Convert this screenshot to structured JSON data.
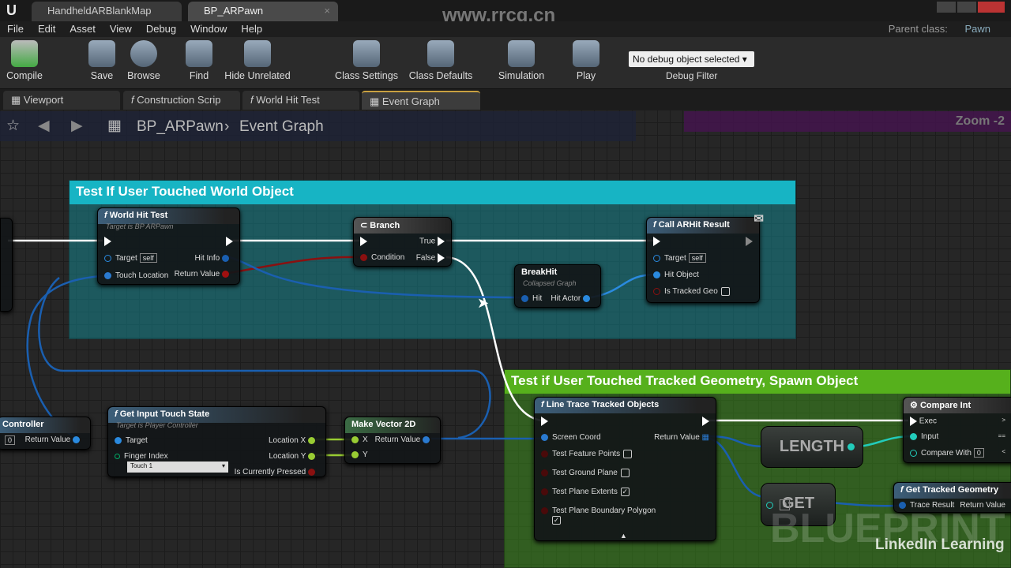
{
  "window": {
    "tabs": [
      {
        "label": "HandheldARBlankMap"
      },
      {
        "label": "BP_ARPawn"
      }
    ],
    "parent_class_label": "Parent class:",
    "parent_class": "Pawn"
  },
  "menu": [
    "File",
    "Edit",
    "Asset",
    "View",
    "Debug",
    "Window",
    "Help"
  ],
  "toolbar": {
    "compile": "Compile",
    "save": "Save",
    "browse": "Browse",
    "find": "Find",
    "hide_unrelated": "Hide Unrelated",
    "class_settings": "Class Settings",
    "class_defaults": "Class Defaults",
    "simulation": "Simulation",
    "play": "Play",
    "debug_select": "No debug object selected",
    "debug_filter": "Debug Filter"
  },
  "graph_tabs": [
    "Viewport",
    "Construction Scrip",
    "World Hit Test",
    "Event Graph"
  ],
  "breadcrumb": {
    "root": "BP_ARPawn",
    "current": "Event Graph"
  },
  "zoom": "Zoom -2",
  "comments": {
    "top": "Test If User Touched World Object",
    "bottom": "Test if User Touched Tracked Geometry, Spawn Object"
  },
  "nodes": {
    "world_hit_test": {
      "title": "World Hit Test",
      "sub": "Target is BP ARPawn",
      "target": "Target",
      "self": "self",
      "touch": "Touch Location",
      "hit_info": "Hit Info",
      "ret": "Return Value"
    },
    "branch": {
      "title": "Branch",
      "condition": "Condition",
      "true": "True",
      "false": "False"
    },
    "break_hit": {
      "title": "BreakHit",
      "sub": "Collapsed Graph",
      "hit": "Hit",
      "hit_actor": "Hit Actor"
    },
    "call_arhit": {
      "title": "Call ARHit Result",
      "target": "Target",
      "self": "self",
      "hit_object": "Hit Object",
      "tracked_geo": "Is Tracked Geo"
    },
    "controller": {
      "title": "Controller",
      "ret": "Return Value",
      "field": "0"
    },
    "touch_state": {
      "title": "Get Input Touch State",
      "sub": "Target is Player Controller",
      "target": "Target",
      "finger": "Finger Index",
      "finger_value": "Touch 1",
      "lx": "Location X",
      "ly": "Location Y",
      "pressed": "Is Currently Pressed"
    },
    "make_vec": {
      "title": "Make Vector 2D",
      "x": "X",
      "y": "Y",
      "ret": "Return Value"
    },
    "line_trace": {
      "title": "Line Trace Tracked Objects",
      "screen": "Screen Coord",
      "ret": "Return Value",
      "p1": "Test Feature Points",
      "p2": "Test Ground Plane",
      "p3": "Test Plane Extents",
      "p4": "Test Plane Boundary Polygon"
    },
    "length": {
      "title": "LENGTH"
    },
    "get": {
      "title": "GET",
      "index": "0"
    },
    "compare": {
      "title": "Compare Int",
      "exec": "Exec",
      "input": "Input",
      "with": "Compare With",
      "with_value": "0",
      "gt": ">",
      "eq": "==",
      "lt": "<"
    },
    "tracked_geo": {
      "title": "Get Tracked Geometry",
      "trace": "Trace Result",
      "ret": "Return Value"
    }
  },
  "watermarks": {
    "site": "www.rrcg.cn",
    "brand": "LinkedIn Learning",
    "bg": "BLUEPRINT"
  }
}
